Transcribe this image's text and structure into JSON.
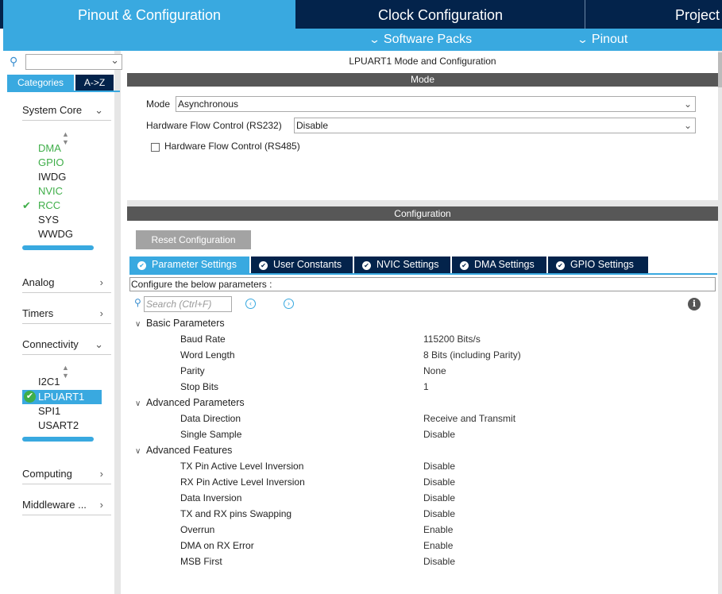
{
  "top_tabs": {
    "pinout_config": "Pinout & Configuration",
    "clock_config": "Clock Configuration",
    "project": "Project Manager"
  },
  "sub_bar": {
    "software_packs": "Software Packs",
    "pinout": "Pinout"
  },
  "left_panel": {
    "search_value": "",
    "tabs": {
      "categories": "Categories",
      "az": "A->Z"
    },
    "system_core": {
      "label": "System Core",
      "items": [
        {
          "label": "DMA"
        },
        {
          "label": "GPIO"
        },
        {
          "label": "IWDG"
        },
        {
          "label": "NVIC"
        },
        {
          "label": "RCC"
        },
        {
          "label": "SYS"
        },
        {
          "label": "WWDG"
        }
      ]
    },
    "analog": "Analog",
    "timers": "Timers",
    "connectivity": {
      "label": "Connectivity",
      "items": [
        {
          "label": "I2C1"
        },
        {
          "label": "LPUART1"
        },
        {
          "label": "SPI1"
        },
        {
          "label": "USART2"
        }
      ]
    },
    "computing": "Computing",
    "middleware": "Middleware ..."
  },
  "mode_panel": {
    "title": "LPUART1 Mode and Configuration",
    "section": "Mode",
    "mode_label": "Mode",
    "mode_value": "Asynchronous",
    "hwfc232_label": "Hardware Flow Control (RS232)",
    "hwfc232_value": "Disable",
    "hwfc485_label": "Hardware Flow Control (RS485)"
  },
  "config_panel": {
    "section": "Configuration",
    "reset_button": "Reset Configuration",
    "tabs": {
      "parameter": "Parameter Settings",
      "user_constants": "User Constants",
      "nvic": "NVIC Settings",
      "dma": "DMA Settings",
      "gpio": "GPIO Settings"
    },
    "configure_text": "Configure the below parameters :",
    "search_placeholder": "Search (Ctrl+F)",
    "basic": {
      "title": "Basic Parameters",
      "params": [
        {
          "name": "Baud Rate",
          "value": "115200 Bits/s"
        },
        {
          "name": "Word Length",
          "value": "8 Bits (including Parity)"
        },
        {
          "name": "Parity",
          "value": "None"
        },
        {
          "name": "Stop Bits",
          "value": "1"
        }
      ]
    },
    "advanced_params": {
      "title": "Advanced Parameters",
      "params": [
        {
          "name": "Data Direction",
          "value": "Receive and Transmit"
        },
        {
          "name": "Single Sample",
          "value": "Disable"
        }
      ]
    },
    "advanced_features": {
      "title": "Advanced Features",
      "params": [
        {
          "name": "TX Pin Active Level Inversion",
          "value": "Disable"
        },
        {
          "name": "RX Pin Active Level Inversion",
          "value": "Disable"
        },
        {
          "name": "Data Inversion",
          "value": "Disable"
        },
        {
          "name": "TX and RX pins Swapping",
          "value": "Disable"
        },
        {
          "name": "Overrun",
          "value": "Enable"
        },
        {
          "name": "DMA on RX Error",
          "value": "Enable"
        },
        {
          "name": "MSB First",
          "value": "Disable"
        }
      ]
    }
  },
  "colors": {
    "accent": "#39a9e0",
    "navy": "#03234b",
    "ok_green": "#3fae49",
    "section_bar": "#575757"
  }
}
